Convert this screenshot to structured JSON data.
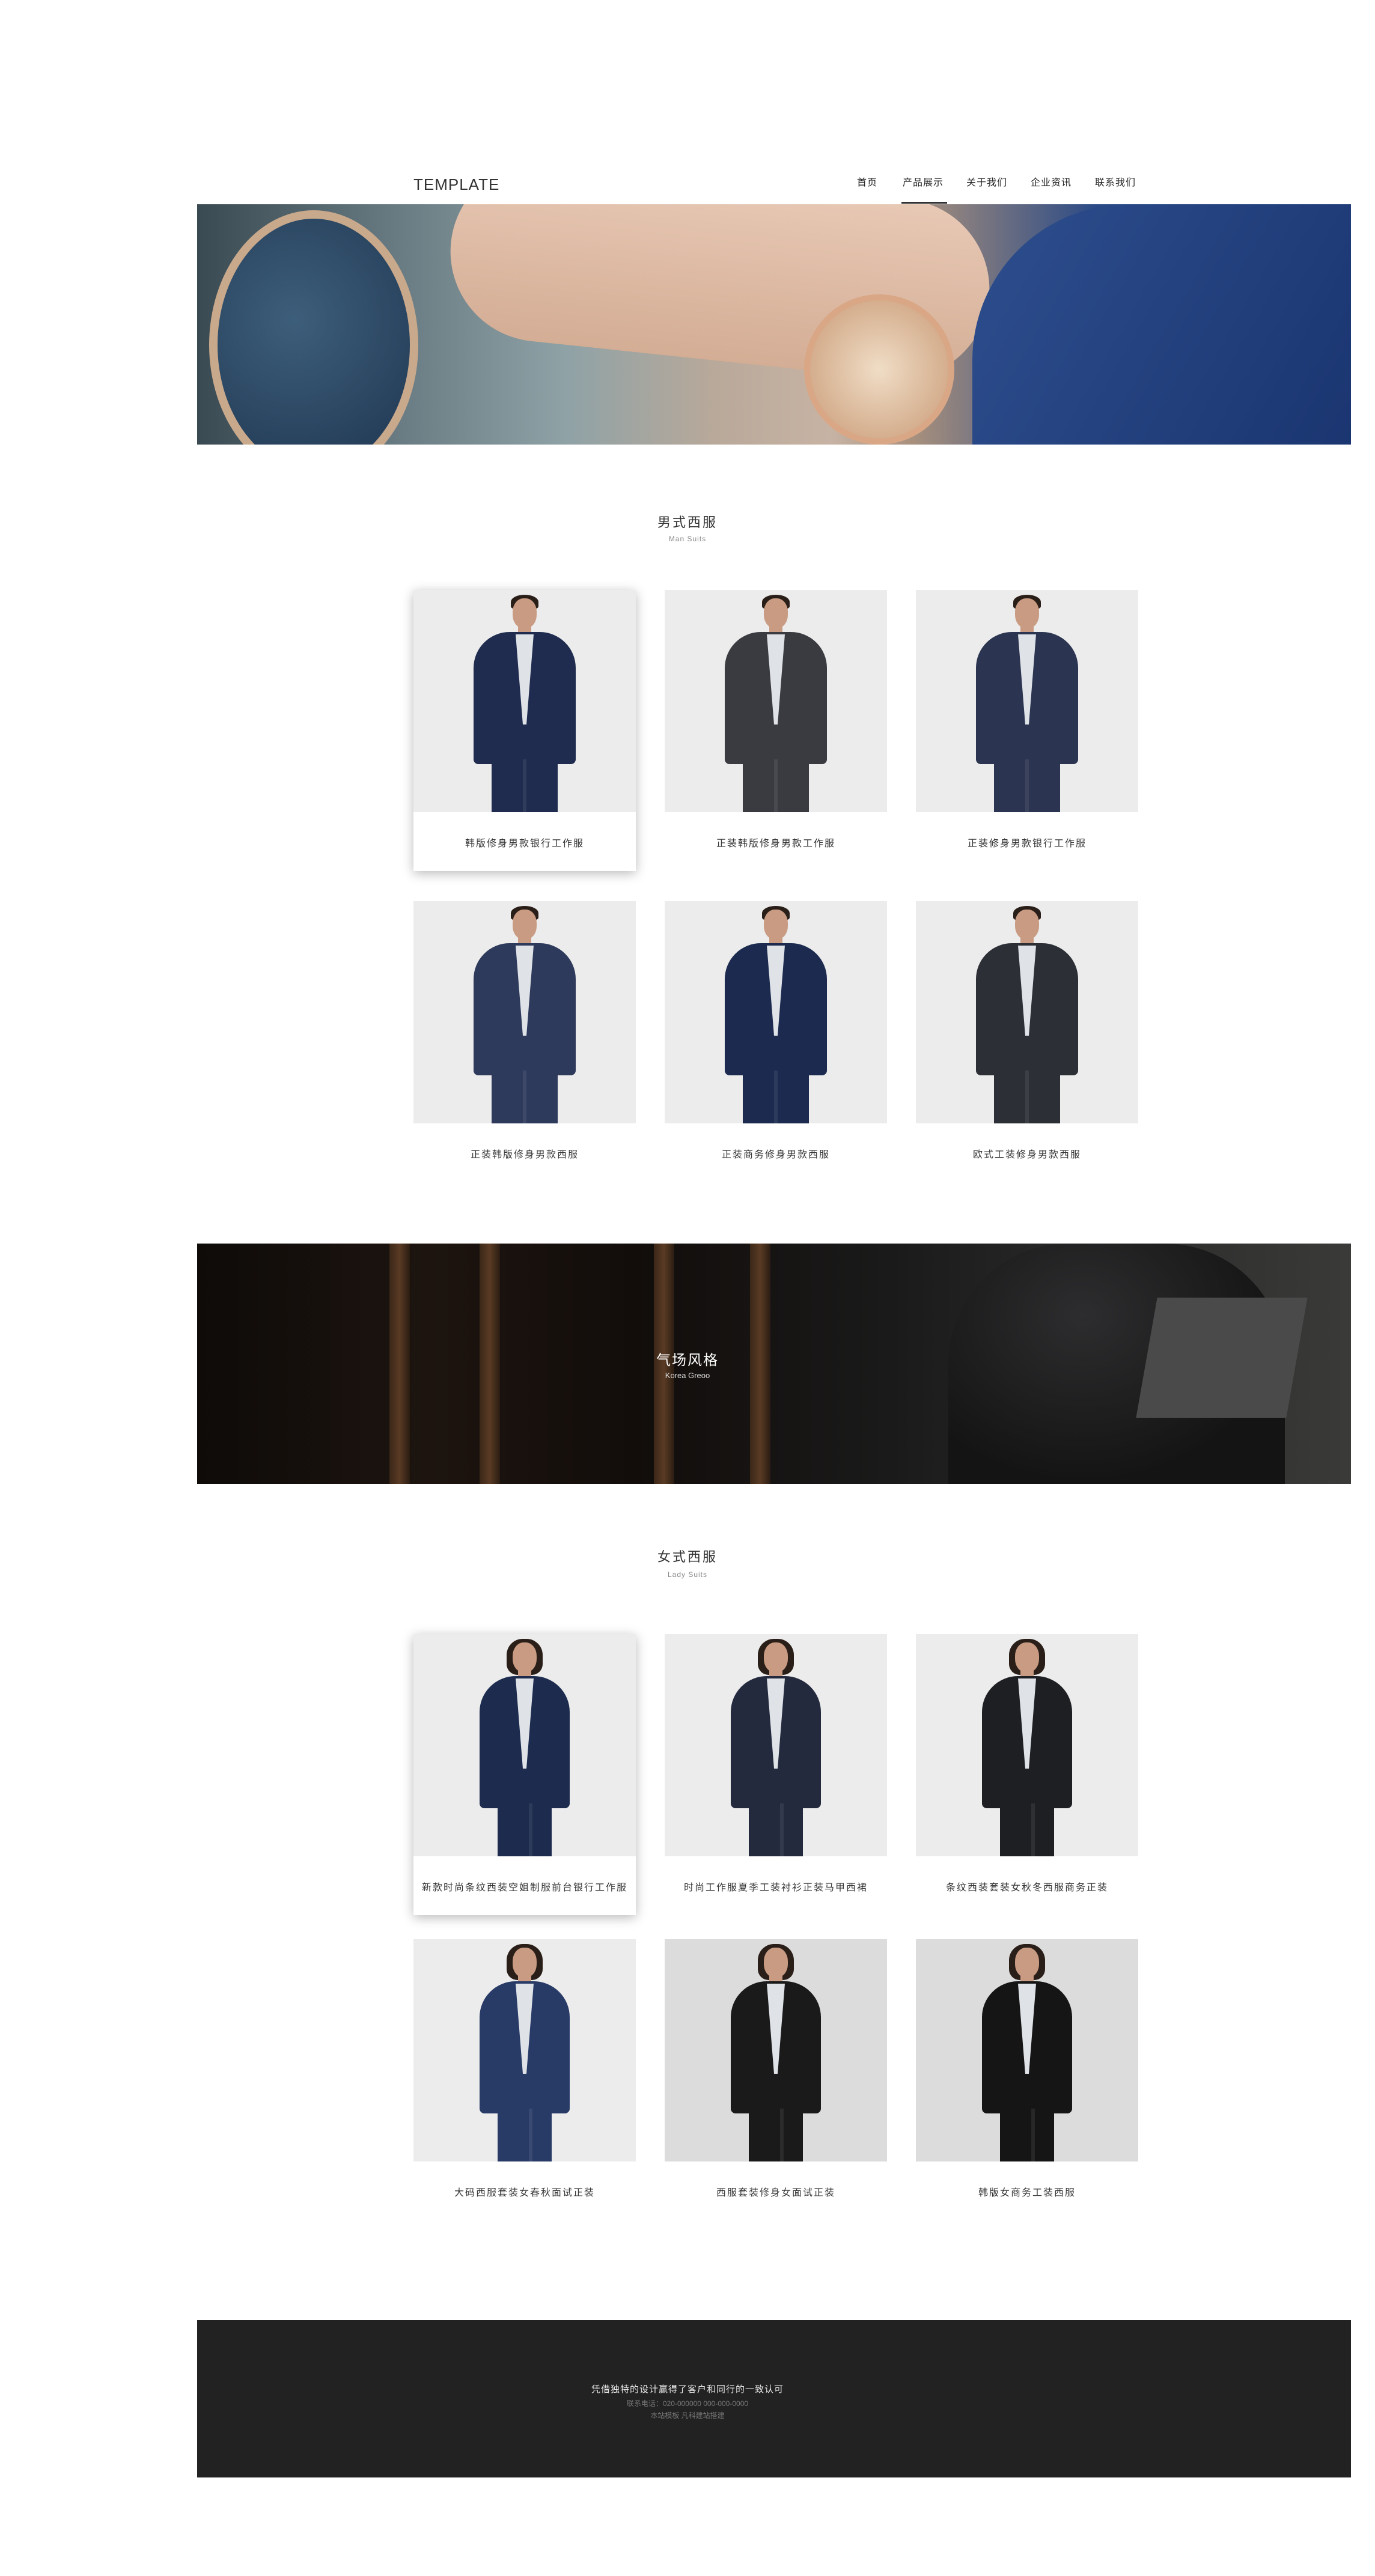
{
  "header": {
    "brand": "TEMPLATE",
    "nav": [
      "首页",
      "产品展示",
      "关于我们",
      "企业资讯",
      "联系我们"
    ],
    "active_index": 1
  },
  "men": {
    "title": "男式西服",
    "subtitle": "Man Suits",
    "items": [
      "韩版修身男款银行工作服",
      "正装韩版修身男款工作服",
      "正装修身男款银行工作服",
      "正装韩版修身男款西服",
      "正装商务修身男款西服",
      "欧式工装修身男款西服"
    ]
  },
  "banner": {
    "title": "气场风格",
    "subtitle": "Korea Greoo"
  },
  "women": {
    "title": "女式西服",
    "subtitle": "Lady Suits",
    "items": [
      "新款时尚条纹西装空姐制服前台银行工作服",
      "时尚工作服夏季工装衬衫正装马甲西裙",
      "条纹西装套装女秋冬西服商务正装",
      "大码西服套装女春秋面试正装",
      "西服套装修身女面试正装",
      "韩版女商务工装西服"
    ]
  },
  "footer": {
    "line1": "凭借独特的设计赢得了客户和同行的一致认可",
    "line2": "联系电话：020-000000  000-000-0000",
    "line3": "本站模板  凡科建站搭建"
  },
  "colors": {
    "footer_bg": "#222222",
    "placeholder_bg": "#ececec"
  }
}
